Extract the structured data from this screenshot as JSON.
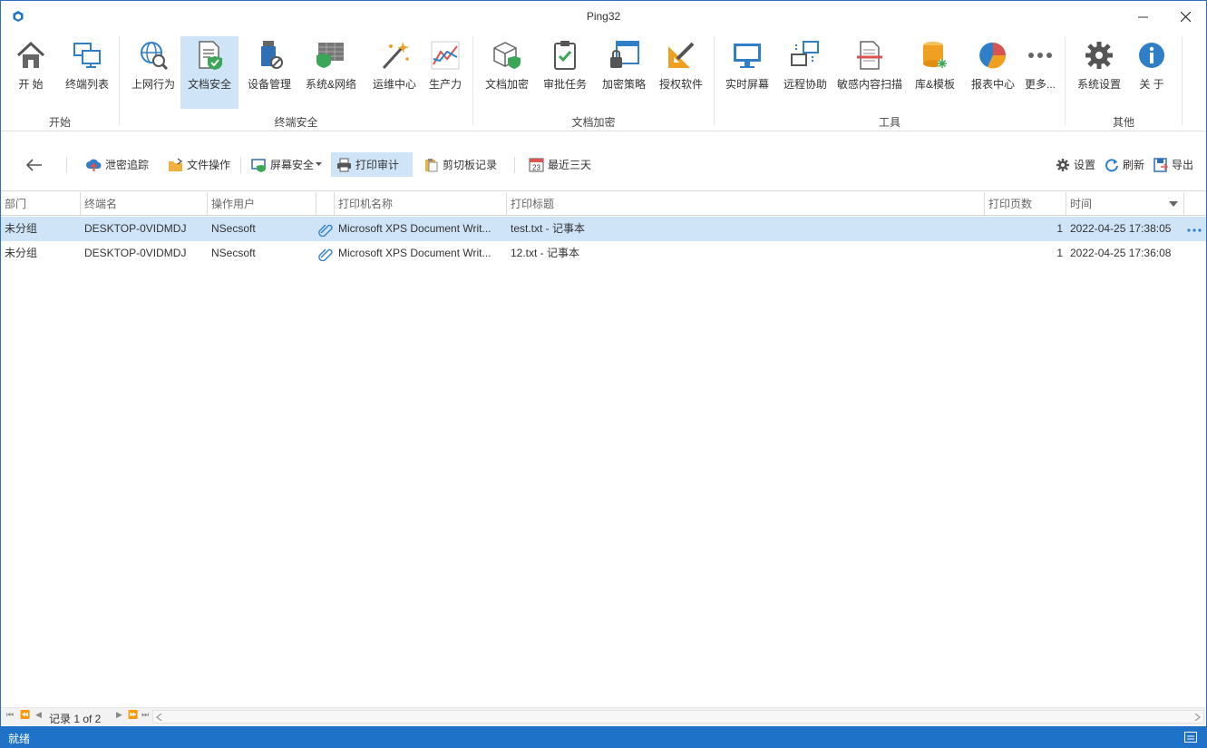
{
  "window": {
    "title": "Ping32"
  },
  "ribbon": {
    "buttons": [
      {
        "label": "开  始",
        "icon": "home-icon"
      },
      {
        "label": "终端列表",
        "icon": "terminal-list-icon"
      },
      {
        "label": "上网行为",
        "icon": "web-behavior-icon"
      },
      {
        "label": "文档安全",
        "icon": "document-security-icon"
      },
      {
        "label": "设备管理",
        "icon": "device-management-icon"
      },
      {
        "label": "系统&网络",
        "icon": "system-network-icon"
      },
      {
        "label": "运维中心",
        "icon": "ops-center-icon"
      },
      {
        "label": "生产力",
        "icon": "productivity-icon"
      },
      {
        "label": "文档加密",
        "icon": "doc-encrypt-icon"
      },
      {
        "label": "审批任务",
        "icon": "approval-task-icon"
      },
      {
        "label": "加密策略",
        "icon": "encrypt-policy-icon"
      },
      {
        "label": "授权软件",
        "icon": "licensed-software-icon"
      },
      {
        "label": "实时屏幕",
        "icon": "realtime-screen-icon"
      },
      {
        "label": "远程协助",
        "icon": "remote-assist-icon"
      },
      {
        "label": "敏感内容扫描",
        "icon": "sensitive-scan-icon"
      },
      {
        "label": "库&模板",
        "icon": "library-template-icon"
      },
      {
        "label": "报表中心",
        "icon": "report-center-icon"
      },
      {
        "label": "更多...",
        "icon": "more-icon"
      },
      {
        "label": "系统设置",
        "icon": "system-settings-icon"
      },
      {
        "label": "关  于",
        "icon": "about-icon"
      }
    ],
    "groups": [
      {
        "label": "开始"
      },
      {
        "label": "终端安全"
      },
      {
        "label": "文档加密"
      },
      {
        "label": "工具"
      },
      {
        "label": "其他"
      }
    ]
  },
  "toolbar": {
    "items": [
      {
        "label": "泄密追踪"
      },
      {
        "label": "文件操作"
      },
      {
        "label": "屏幕安全"
      },
      {
        "label": "打印审计"
      },
      {
        "label": "剪切板记录"
      },
      {
        "label": "最近三天"
      }
    ],
    "calendar_day": "23",
    "right": [
      {
        "label": "设置"
      },
      {
        "label": "刷新"
      },
      {
        "label": "导出"
      }
    ]
  },
  "grid": {
    "columns": [
      "部门",
      "终端名",
      "操作用户",
      "打印机名称",
      "打印标题",
      "打印页数",
      "时间"
    ],
    "rows": [
      [
        "未分组",
        "DESKTOP-0VIDMDJ",
        "NSecsoft",
        "Microsoft XPS Document Writ...",
        "test.txt - 记事本",
        "1",
        "2022-04-25 17:38:05"
      ],
      [
        "未分组",
        "DESKTOP-0VIDMDJ",
        "NSecsoft",
        "Microsoft XPS Document Writ...",
        "12.txt - 记事本",
        "1",
        "2022-04-25 17:36:08"
      ]
    ]
  },
  "pager": {
    "record_text": "记录 1 of 2"
  },
  "status": {
    "text": "就绪"
  },
  "colors": {
    "accent": "#1e73c8",
    "selected": "#cfe4f7"
  }
}
